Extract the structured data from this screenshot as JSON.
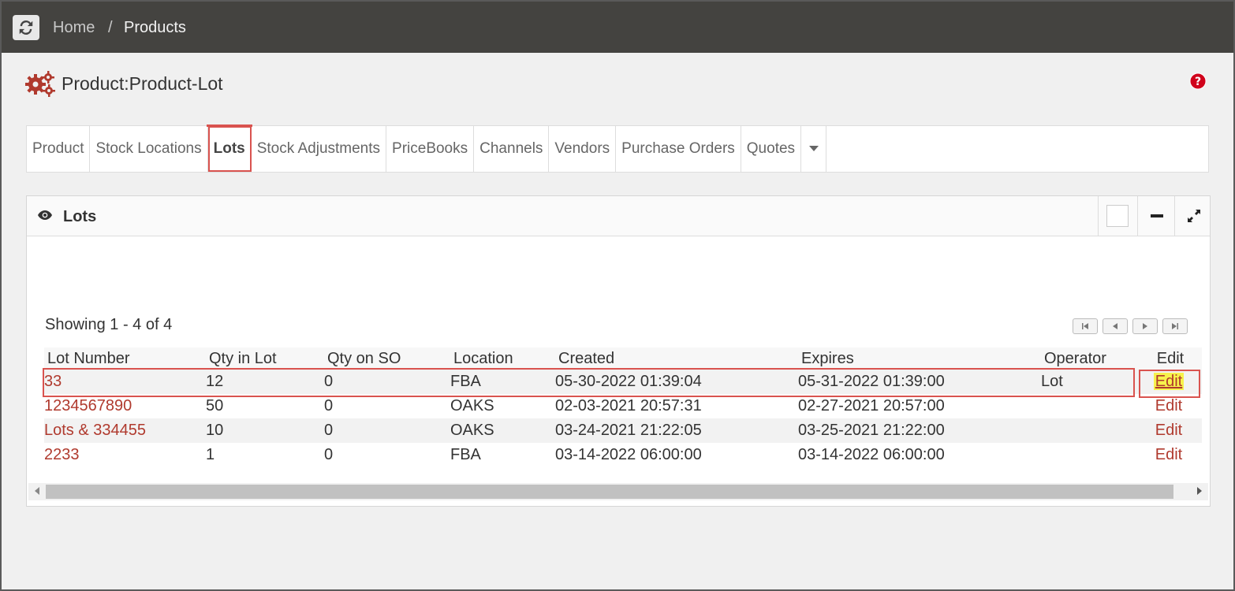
{
  "breadcrumb": {
    "home": "Home",
    "separator": "/",
    "current": "Products"
  },
  "page": {
    "title": "Product:Product-Lot"
  },
  "tabs": [
    {
      "label": "Product"
    },
    {
      "label": "Stock Locations"
    },
    {
      "label": "Lots",
      "active": true
    },
    {
      "label": "Stock Adjustments"
    },
    {
      "label": "PriceBooks"
    },
    {
      "label": "Channels"
    },
    {
      "label": "Vendors"
    },
    {
      "label": "Purchase Orders"
    },
    {
      "label": "Quotes"
    }
  ],
  "panel": {
    "title": "Lots",
    "showing": "Showing 1 - 4 of 4"
  },
  "table": {
    "columns": [
      "Lot Number",
      "Qty in Lot",
      "Qty on SO",
      "Location",
      "Created",
      "Expires",
      "Operator",
      "Edit"
    ],
    "rows": [
      {
        "lot": "33",
        "qty": "12",
        "qty_so": "0",
        "location": "FBA",
        "created": "05-30-2022 01:39:04",
        "expires": "05-31-2022 01:39:00",
        "operator": "Lot",
        "edit": "Edit"
      },
      {
        "lot": "1234567890",
        "qty": "50",
        "qty_so": "0",
        "location": "OAKS",
        "created": "02-03-2021 20:57:31",
        "expires": "02-27-2021 20:57:00",
        "operator": "",
        "edit": "Edit"
      },
      {
        "lot": "Lots & 334455",
        "qty": "10",
        "qty_so": "0",
        "location": "OAKS",
        "created": "03-24-2021 21:22:05",
        "expires": "03-25-2021 21:22:00",
        "operator": "",
        "edit": "Edit"
      },
      {
        "lot": "2233",
        "qty": "1",
        "qty_so": "0",
        "location": "FBA",
        "created": "03-14-2022 06:00:00",
        "expires": "03-14-2022 06:00:00",
        "operator": "",
        "edit": "Edit"
      }
    ]
  },
  "colors": {
    "topbar": "#444340",
    "accent_red": "#d9534f",
    "link": "#b03a2e",
    "expired": "#d0021b",
    "highlight": "#f7f24c"
  },
  "icons": {
    "refresh": "refresh-icon",
    "gears": "gears-icon",
    "help": "help-icon",
    "eye": "eye-icon"
  }
}
